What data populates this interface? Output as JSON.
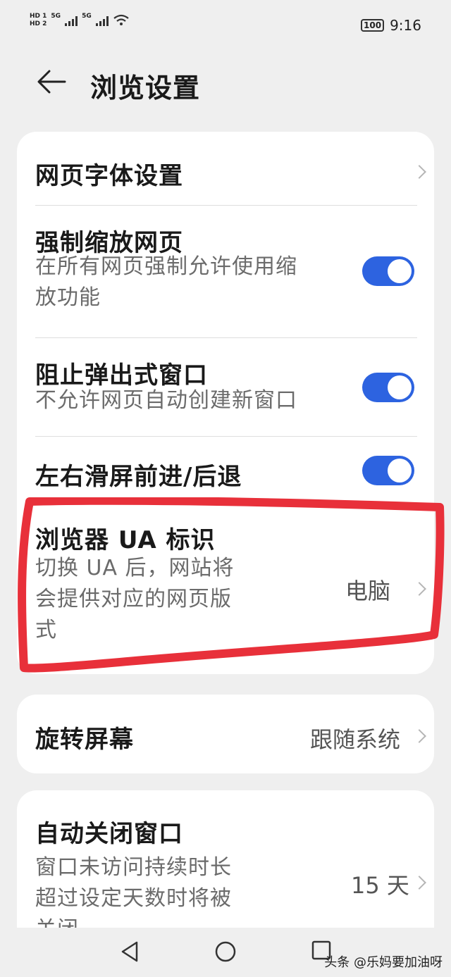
{
  "status_bar": {
    "hd1": "HD 1",
    "hd2": "HD 2",
    "net1": "5G",
    "net2": "5G",
    "battery": "100",
    "time": "9:16"
  },
  "header": {
    "title": "浏览设置"
  },
  "card1": {
    "font_settings": {
      "title": "网页字体设置"
    },
    "force_zoom": {
      "title": "强制缩放网页",
      "desc": [
        "在所有网页强制允许使用缩",
        "放功能"
      ],
      "enabled": true
    },
    "block_popups": {
      "title": "阻止弹出式窗口",
      "desc": [
        "不允许网页自动创建新窗口"
      ],
      "enabled": true
    },
    "swipe_nav": {
      "title": "左右滑屏前进/后退",
      "enabled": true
    },
    "ua": {
      "title": "浏览器 UA 标识",
      "desc": [
        "切换 UA 后，网站将",
        "会提供对应的网页版",
        "式"
      ],
      "value": "电脑"
    }
  },
  "card2": {
    "rotate": {
      "title": "旋转屏幕",
      "value": "跟随系统"
    }
  },
  "card3": {
    "auto_close": {
      "title": "自动关闭窗口",
      "desc": [
        "窗口未访问持续时长",
        "超过设定天数时将被",
        "关闭"
      ],
      "value": "15 天"
    }
  },
  "annotation": {
    "color": "#e8303a"
  },
  "watermark": "头条 @乐妈要加油呀",
  "colors": {
    "toggle_on": "#2d63e0",
    "background": "#efefef",
    "card": "#ffffff"
  }
}
